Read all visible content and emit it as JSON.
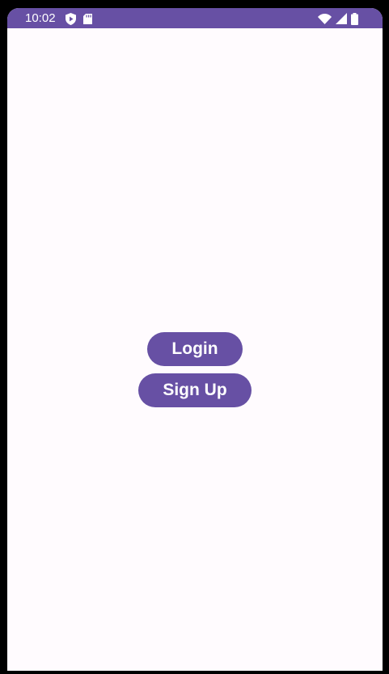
{
  "status_bar": {
    "time": "10:02",
    "left_icons": [
      "shield-play-icon",
      "sd-card-icon"
    ],
    "right_icons": [
      "wifi-icon",
      "cell-signal-icon",
      "battery-icon"
    ]
  },
  "buttons": {
    "login_label": "Login",
    "signup_label": "Sign Up"
  },
  "colors": {
    "accent": "#6750a4",
    "background": "#fffbfe",
    "on_accent": "#ffffff"
  }
}
